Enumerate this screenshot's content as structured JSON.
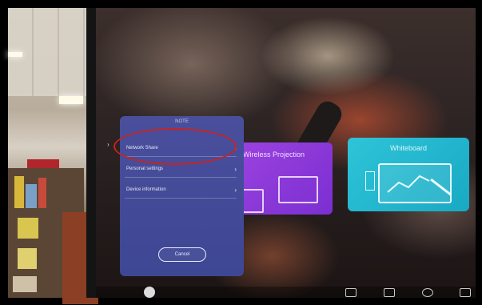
{
  "settings_panel": {
    "title": "NOTE",
    "items": [
      {
        "label": "Network Share"
      },
      {
        "label": "Personal settings"
      },
      {
        "label": "Device information"
      }
    ],
    "cancel_label": "Cancel"
  },
  "tiles": [
    {
      "label": "Wireless Projection",
      "icon": "projection-icon",
      "color": "#8f3ad8"
    },
    {
      "label": "Whiteboard",
      "icon": "whiteboard-icon",
      "color": "#27b7cf"
    }
  ],
  "annotation": {
    "color": "#c8231f"
  }
}
